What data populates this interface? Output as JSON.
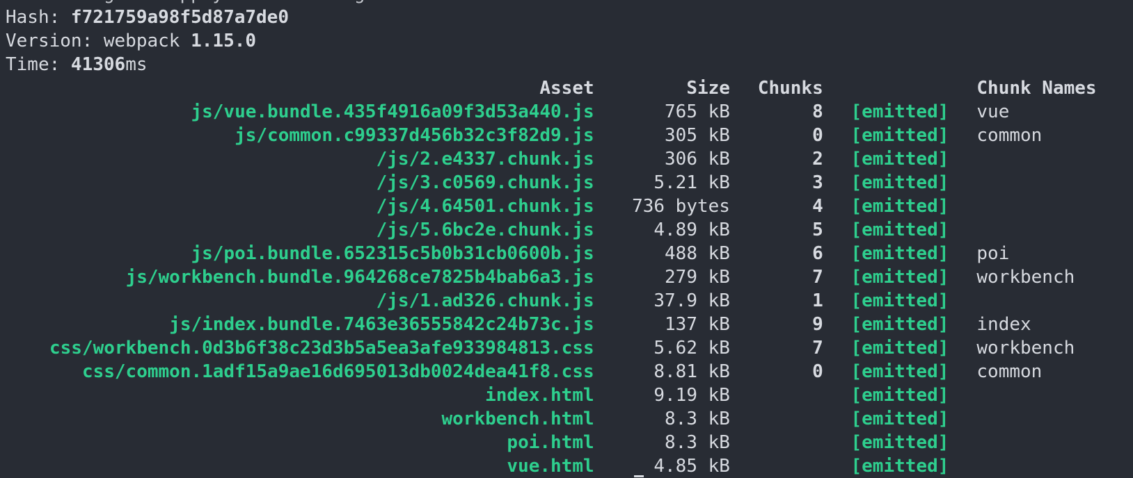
{
  "top_partial_line": "rebuilding ... apply ... building ... ",
  "info": {
    "hash_label": "Hash: ",
    "hash_value": "f721759a98f5d87a7de0",
    "version_label": "Version: webpack ",
    "version_value": "1.15.0",
    "time_label": "Time: ",
    "time_value": "41306",
    "time_unit": "ms"
  },
  "table": {
    "headers": {
      "asset": "Asset",
      "size": "Size",
      "chunks": "Chunks",
      "chunk_names": "Chunk Names"
    },
    "rows": [
      {
        "asset": "js/vue.bundle.435f4916a09f3d53a440.js",
        "size": "765 kB",
        "chunks": "8",
        "status": "[emitted]",
        "name": "vue"
      },
      {
        "asset": "js/common.c99337d456b32c3f82d9.js",
        "size": "305 kB",
        "chunks": "0",
        "status": "[emitted]",
        "name": "common"
      },
      {
        "asset": "/js/2.e4337.chunk.js",
        "size": "306 kB",
        "chunks": "2",
        "status": "[emitted]",
        "name": ""
      },
      {
        "asset": "/js/3.c0569.chunk.js",
        "size": "5.21 kB",
        "chunks": "3",
        "status": "[emitted]",
        "name": ""
      },
      {
        "asset": "/js/4.64501.chunk.js",
        "size": "736 bytes",
        "chunks": "4",
        "status": "[emitted]",
        "name": ""
      },
      {
        "asset": "/js/5.6bc2e.chunk.js",
        "size": "4.89 kB",
        "chunks": "5",
        "status": "[emitted]",
        "name": ""
      },
      {
        "asset": "js/poi.bundle.652315c5b0b31cb0600b.js",
        "size": "488 kB",
        "chunks": "6",
        "status": "[emitted]",
        "name": "poi"
      },
      {
        "asset": "js/workbench.bundle.964268ce7825b4bab6a3.js",
        "size": "279 kB",
        "chunks": "7",
        "status": "[emitted]",
        "name": "workbench"
      },
      {
        "asset": "/js/1.ad326.chunk.js",
        "size": "37.9 kB",
        "chunks": "1",
        "status": "[emitted]",
        "name": ""
      },
      {
        "asset": "js/index.bundle.7463e36555842c24b73c.js",
        "size": "137 kB",
        "chunks": "9",
        "status": "[emitted]",
        "name": "index"
      },
      {
        "asset": "css/workbench.0d3b6f38c23d3b5a5ea3afe933984813.css",
        "size": "5.62 kB",
        "chunks": "7",
        "status": "[emitted]",
        "name": "workbench"
      },
      {
        "asset": "css/common.1adf15a9ae16d695013db0024dea41f8.css",
        "size": "8.81 kB",
        "chunks": "0",
        "status": "[emitted]",
        "name": "common"
      },
      {
        "asset": "index.html",
        "size": "9.19 kB",
        "chunks": "",
        "status": "[emitted]",
        "name": ""
      },
      {
        "asset": "workbench.html",
        "size": "8.3 kB",
        "chunks": "",
        "status": "[emitted]",
        "name": ""
      },
      {
        "asset": "poi.html",
        "size": "8.3 kB",
        "chunks": "",
        "status": "[emitted]",
        "name": ""
      },
      {
        "asset": "vue.html",
        "size": "4.85 kB",
        "chunks": "",
        "status": "[emitted]",
        "name": ""
      }
    ]
  },
  "colors": {
    "background": "#282c34",
    "foreground": "#d7dae0",
    "accent_green": "#2ecf8e"
  }
}
